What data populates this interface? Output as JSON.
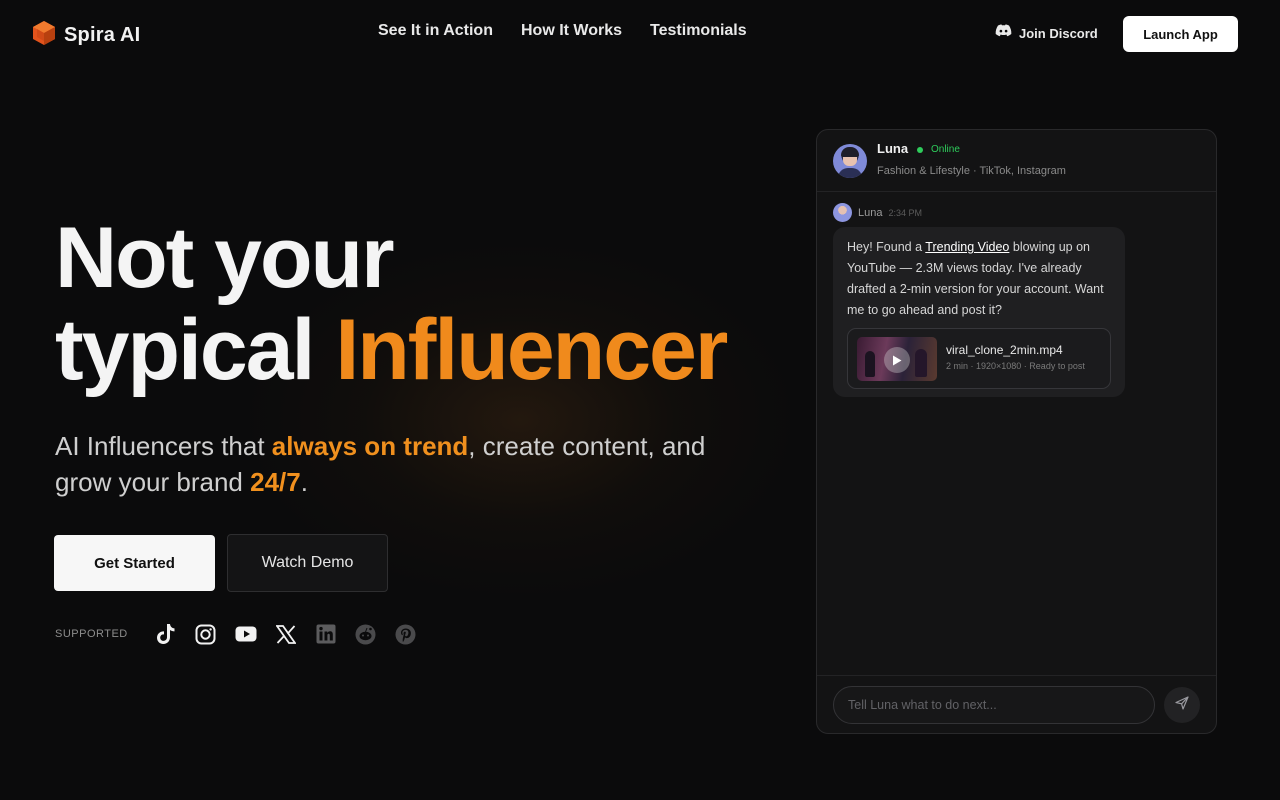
{
  "nav": {
    "brand": "Spira AI",
    "links": [
      "See It in Action",
      "How It Works",
      "Testimonials"
    ],
    "discord_label": "Join Discord",
    "launch_label": "Launch App"
  },
  "hero": {
    "title_line1": "Not your",
    "title_line2_plain": "typical ",
    "title_line2_accent": "Influencer",
    "sub_part1": "AI Influencers that ",
    "sub_hl1": "always on trend",
    "sub_part2": ", create content, and grow your brand ",
    "sub_hl2": "24/7",
    "sub_part3": ".",
    "primary_button": "Get Started",
    "secondary_button": "Watch Demo",
    "supported_label": "SUPPORTED",
    "platforms": [
      "tiktok-icon",
      "instagram-icon",
      "youtube-icon",
      "x-icon",
      "linkedin-icon",
      "reddit-icon",
      "pinterest-icon"
    ]
  },
  "chat": {
    "name": "Luna",
    "status": "Online",
    "niche": "Fashion & Lifestyle · TikTok, Instagram",
    "message": {
      "sender": "Luna",
      "time": "2:34 PM",
      "text_before": "Hey! Found a ",
      "link_text": "Trending Video",
      "text_after": " blowing up on YouTube — 2.3M views today. I've already drafted a 2-min version for your account. Want me to go ahead and post it?",
      "attachment_name": "viral_clone_2min.mp4",
      "attachment_meta": "2 min · 1920×1080 · Ready to post"
    },
    "input_placeholder": "Tell Luna what to do next..."
  },
  "colors": {
    "accent": "#f08a1c",
    "online": "#2ecc5b",
    "background": "#0b0b0c"
  }
}
